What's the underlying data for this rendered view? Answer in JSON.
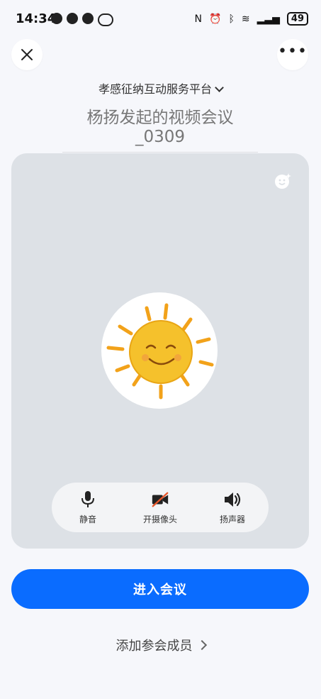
{
  "status_bar": {
    "time": "14:34",
    "battery": "49"
  },
  "header": {
    "org_name": "孝感征纳互动服务平台",
    "meeting_title": "杨扬发起的视频会议_0309"
  },
  "controls": [
    {
      "label": "静音",
      "icon": "microphone-icon"
    },
    {
      "label": "开摄像头",
      "icon": "camera-off-icon"
    },
    {
      "label": "扬声器",
      "icon": "speaker-icon"
    }
  ],
  "actions": {
    "join_label": "进入会议",
    "add_members_label": "添加参会成员"
  },
  "colors": {
    "primary": "#0a6cff",
    "preview_bg": "#dde1e6",
    "page_bg": "#f6f7fb"
  }
}
